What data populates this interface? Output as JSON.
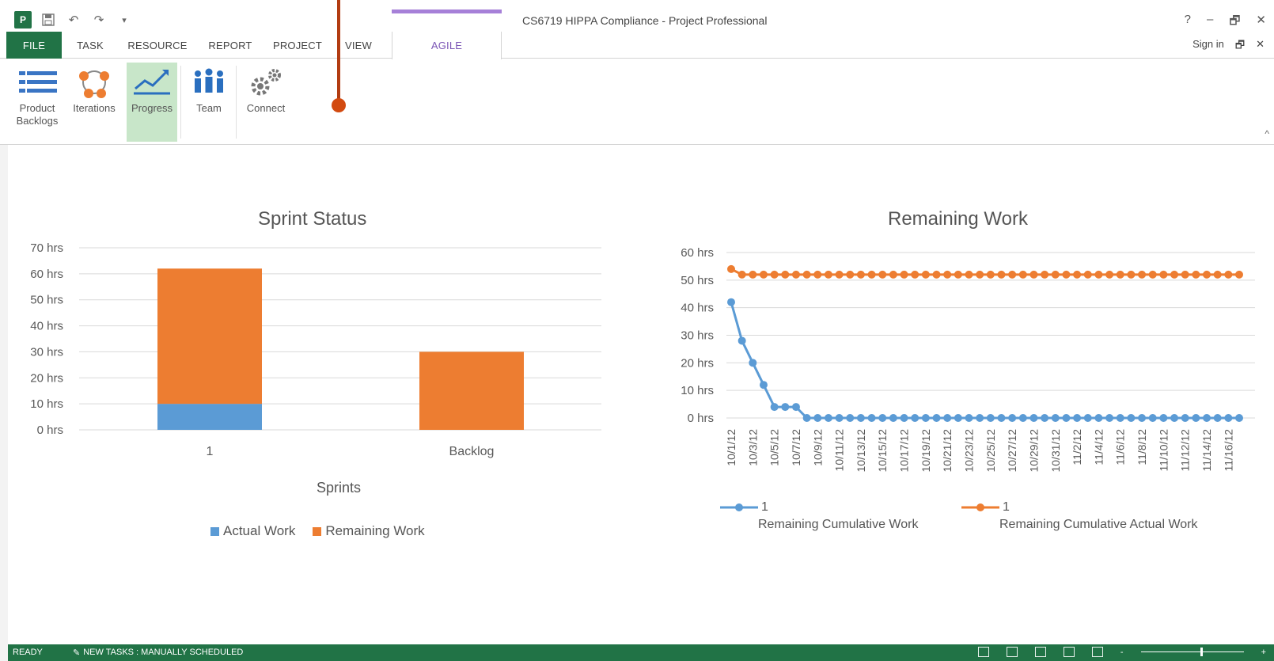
{
  "window": {
    "title": "CS6719 HIPPA Compliance - Project Professional",
    "controls": [
      "?",
      "–",
      "🗗",
      "✕"
    ],
    "signin": "Sign in"
  },
  "qat": {
    "app_icon": "P",
    "items": [
      "save-icon",
      "undo-icon",
      "redo-icon",
      "customize-icon"
    ]
  },
  "tabs": [
    "FILE",
    "TASK",
    "RESOURCE",
    "REPORT",
    "PROJECT",
    "VIEW",
    "AGILE"
  ],
  "ribbon": {
    "buttons": [
      {
        "label1": "Product",
        "label2": "Backlogs",
        "icon": "list-icon"
      },
      {
        "label1": "Iterations",
        "label2": "",
        "icon": "iterations-icon"
      },
      {
        "label1": "Progress",
        "label2": "",
        "icon": "progress-chart-icon",
        "active": true
      },
      {
        "label1": "Team",
        "label2": "",
        "icon": "team-icon"
      },
      {
        "label1": "Connect",
        "label2": "",
        "icon": "gears-icon"
      }
    ]
  },
  "colors": {
    "accent_green": "#217346",
    "actual": "#5b9bd5",
    "remaining": "#ed7d31",
    "agile": "#7b55b5"
  },
  "charts": {
    "sprint_status": {
      "title": "Sprint Status",
      "xlabel": "Sprints",
      "legend": [
        "Actual Work",
        "Remaining Work"
      ]
    },
    "remaining_work": {
      "title": "Remaining Work",
      "legend": [
        {
          "marker": "1",
          "name": "Remaining Cumulative Work"
        },
        {
          "marker": "1",
          "name": "Remaining Cumulative Actual Work"
        }
      ]
    }
  },
  "chart_data": [
    {
      "type": "bar",
      "stacked": true,
      "title": "Sprint Status",
      "xlabel": "Sprints",
      "ylabel": "",
      "categories": [
        "1",
        "Backlog"
      ],
      "series": [
        {
          "name": "Actual Work",
          "values": [
            10,
            0
          ],
          "color": "#5b9bd5"
        },
        {
          "name": "Remaining Work",
          "values": [
            52,
            30
          ],
          "color": "#ed7d31"
        }
      ],
      "ylim": [
        0,
        70
      ],
      "yticks": [
        "0 hrs",
        "10 hrs",
        "20 hrs",
        "30 hrs",
        "40 hrs",
        "50 hrs",
        "60 hrs",
        "70 hrs"
      ],
      "grid": true,
      "legend": "bottom"
    },
    {
      "type": "line",
      "title": "Remaining Work",
      "xlabel": "",
      "ylabel": "",
      "x": [
        "10/1/12",
        "10/2/12",
        "10/3/12",
        "10/4/12",
        "10/5/12",
        "10/6/12",
        "10/7/12",
        "10/8/12",
        "10/9/12",
        "10/10/12",
        "10/11/12",
        "10/12/12",
        "10/13/12",
        "10/14/12",
        "10/15/12",
        "10/16/12",
        "10/17/12",
        "10/18/12",
        "10/19/12",
        "10/20/12",
        "10/21/12",
        "10/22/12",
        "10/23/12",
        "10/24/12",
        "10/25/12",
        "10/26/12",
        "10/27/12",
        "10/28/12",
        "10/29/12",
        "10/30/12",
        "10/31/12",
        "11/1/12",
        "11/2/12",
        "11/3/12",
        "11/4/12",
        "11/5/12",
        "11/6/12",
        "11/7/12",
        "11/8/12",
        "11/9/12",
        "11/10/12",
        "11/11/12",
        "11/12/12",
        "11/13/12",
        "11/14/12",
        "11/15/12",
        "11/16/12",
        "11/17/12"
      ],
      "xtick_labels": [
        "10/1/12",
        "10/3/12",
        "10/5/12",
        "10/7/12",
        "10/9/12",
        "10/11/12",
        "10/13/12",
        "10/15/12",
        "10/17/12",
        "10/19/12",
        "10/21/12",
        "10/23/12",
        "10/25/12",
        "10/27/12",
        "10/29/12",
        "10/31/12",
        "11/2/12",
        "11/4/12",
        "11/6/12",
        "11/8/12",
        "11/10/12",
        "11/12/12",
        "11/14/12",
        "11/16/12"
      ],
      "series": [
        {
          "name": "Remaining Cumulative Work",
          "color": "#5b9bd5",
          "values": [
            42,
            28,
            20,
            12,
            4,
            4,
            4,
            0,
            0,
            0,
            0,
            0,
            0,
            0,
            0,
            0,
            0,
            0,
            0,
            0,
            0,
            0,
            0,
            0,
            0,
            0,
            0,
            0,
            0,
            0,
            0,
            0,
            0,
            0,
            0,
            0,
            0,
            0,
            0,
            0,
            0,
            0,
            0,
            0,
            0,
            0,
            0,
            0
          ]
        },
        {
          "name": "Remaining Cumulative Actual Work",
          "color": "#ed7d31",
          "values": [
            54,
            52,
            52,
            52,
            52,
            52,
            52,
            52,
            52,
            52,
            52,
            52,
            52,
            52,
            52,
            52,
            52,
            52,
            52,
            52,
            52,
            52,
            52,
            52,
            52,
            52,
            52,
            52,
            52,
            52,
            52,
            52,
            52,
            52,
            52,
            52,
            52,
            52,
            52,
            52,
            52,
            52,
            52,
            52,
            52,
            52,
            52,
            52
          ]
        }
      ],
      "ylim": [
        0,
        60
      ],
      "yticks": [
        "0 hrs",
        "10 hrs",
        "20 hrs",
        "30 hrs",
        "40 hrs",
        "50 hrs",
        "60 hrs"
      ],
      "grid": true,
      "legend": "bottom"
    }
  ],
  "statusbar": {
    "ready": "READY",
    "mode": "NEW TASKS : MANUALLY SCHEDULED",
    "zoom_minus": "-",
    "zoom_plus": "+"
  }
}
